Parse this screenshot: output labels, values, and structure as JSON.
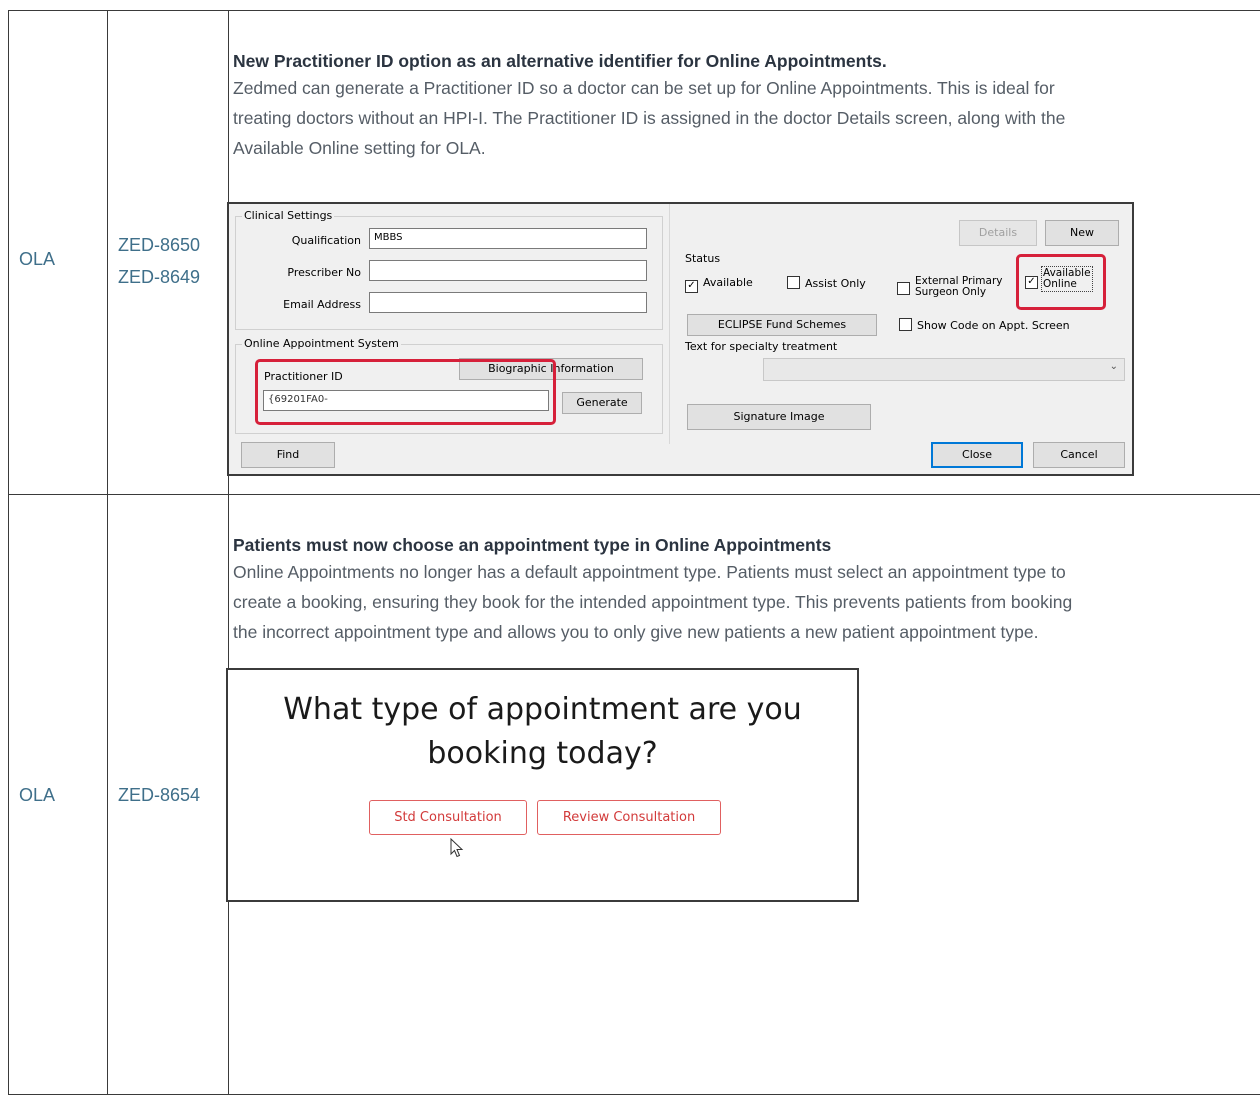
{
  "rows": [
    {
      "category": "OLA",
      "tickets": [
        "ZED-8650",
        "ZED-8649"
      ],
      "title": "New Practitioner ID option as an alternative identifier for Online Appointments.",
      "desc_lines": [
        "Zedmed can generate a Practitioner ID so a doctor can be set up for Online Appointments. This is ideal for",
        "treating doctors without an HPI-I. The Practitioner ID is assigned in the doctor Details screen, along with the",
        "Available Online setting for OLA."
      ]
    },
    {
      "category": "OLA",
      "tickets": [
        "ZED-8654"
      ],
      "title": "Patients must now choose an appointment type in Online Appointments",
      "desc_lines": [
        "Online Appointments no longer has a default appointment type. Patients must select an appointment type to",
        "create a booking,  ensuring they book for the intended appointment type. This prevents patients from booking",
        "the incorrect appointment type and allows you to only give new patients a new patient appointment type."
      ]
    }
  ],
  "dialog": {
    "clinical_settings": "Clinical Settings",
    "qualification_label": "Qualification",
    "qualification_value": "MBBS",
    "prescriber_label": "Prescriber No",
    "email_label": "Email Address",
    "online_system": "Online Appointment System",
    "biographic": "Biographic Information",
    "practitioner_id_label": "Practitioner ID",
    "practitioner_id_value": "{69201FA0-",
    "generate": "Generate",
    "find": "Find",
    "details": "Details",
    "new": "New",
    "status": "Status",
    "available": "Available",
    "assist_only": "Assist Only",
    "external_primary": "External Primary",
    "surgeon_only": "Surgeon Only",
    "available_online_1": "Available",
    "available_online_2": "Online",
    "eclipse": "ECLIPSE Fund Schemes",
    "show_code": "Show Code on Appt. Screen",
    "specialty_label": "Text for specialty treatment",
    "signature": "Signature Image",
    "close": "Close",
    "cancel": "Cancel"
  },
  "booking": {
    "question_line1": "What type of appointment are you",
    "question_line2": "booking today?",
    "std": "Std Consultation",
    "review": "Review Consultation"
  }
}
